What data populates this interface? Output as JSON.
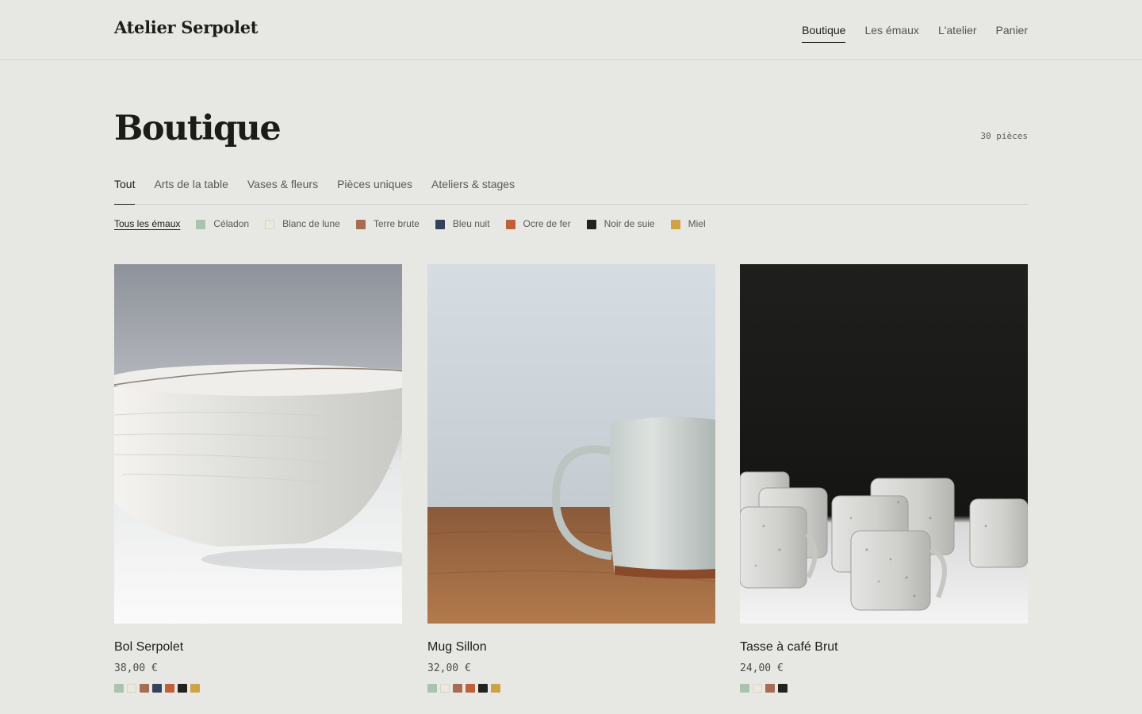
{
  "brand": "Atelier Serpolet",
  "nav": [
    {
      "label": "Boutique",
      "active": true
    },
    {
      "label": "Les émaux",
      "active": false
    },
    {
      "label": "L'atelier",
      "active": false
    },
    {
      "label": "Panier",
      "active": false
    }
  ],
  "page": {
    "title": "Boutique",
    "count": "30 pièces"
  },
  "categories": [
    {
      "label": "Tout",
      "active": true
    },
    {
      "label": "Arts de la table",
      "active": false
    },
    {
      "label": "Vases & fleurs",
      "active": false
    },
    {
      "label": "Pièces uniques",
      "active": false
    },
    {
      "label": "Ateliers & stages",
      "active": false
    }
  ],
  "glaze_filter": {
    "all_label": "Tous les émaux",
    "glazes": [
      {
        "label": "Céladon",
        "color": "#a8c4b0"
      },
      {
        "label": "Blanc de lune",
        "color": "#ece8dc"
      },
      {
        "label": "Terre brute",
        "color": "#a86c52"
      },
      {
        "label": "Bleu nuit",
        "color": "#34425a"
      },
      {
        "label": "Ocre de fer",
        "color": "#c0603a"
      },
      {
        "label": "Noir de suie",
        "color": "#23221f"
      },
      {
        "label": "Miel",
        "color": "#d0a246"
      }
    ]
  },
  "products": [
    {
      "name": "Bol Serpolet",
      "price": "38,00 €",
      "image": "white-bowl",
      "glazes": [
        "#a8c4b0",
        "#ece8dc",
        "#a86c52",
        "#34425a",
        "#c0603a",
        "#23221f",
        "#d0a246"
      ]
    },
    {
      "name": "Mug Sillon",
      "price": "32,00 €",
      "image": "white-mug-on-wood",
      "glazes": [
        "#a8c4b0",
        "#ece8dc",
        "#a86c52",
        "#c0603a",
        "#23221f",
        "#d0a246"
      ]
    },
    {
      "name": "Tasse à café Brut",
      "price": "24,00 €",
      "image": "speckled-cups",
      "glazes": [
        "#a8c4b0",
        "#ece8dc",
        "#a86c52",
        "#23221f"
      ]
    }
  ]
}
